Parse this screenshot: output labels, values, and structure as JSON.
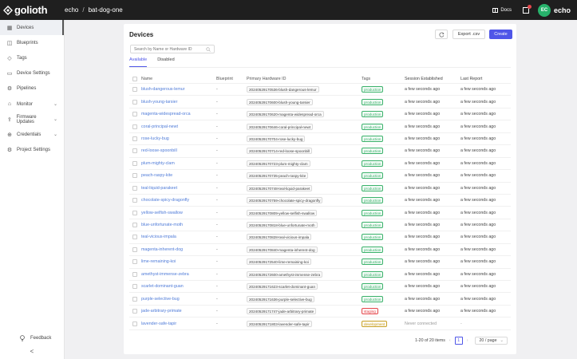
{
  "topbar": {
    "logo_text": "golioth",
    "breadcrumb": [
      "echo",
      "bat-dog-one"
    ],
    "docs_label": "Docs",
    "avatar_initials": "EC",
    "user_name": "echo"
  },
  "sidebar": {
    "items": [
      {
        "label": "Devices",
        "icon": "devices-icon",
        "active": true
      },
      {
        "label": "Blueprints",
        "icon": "blueprint-icon"
      },
      {
        "label": "Tags",
        "icon": "tag-icon"
      },
      {
        "label": "Device Settings",
        "icon": "settings-icon"
      },
      {
        "label": "Pipelines",
        "icon": "pipeline-icon"
      },
      {
        "label": "Monitor",
        "icon": "monitor-icon",
        "chevron": true
      },
      {
        "label": "Firmware Updates",
        "icon": "firmware-icon",
        "chevron": true
      },
      {
        "label": "Credentials",
        "icon": "credentials-icon",
        "chevron": true
      },
      {
        "label": "Project Settings",
        "icon": "project-settings-icon"
      }
    ],
    "feedback_label": "Feedback",
    "collapse_glyph": "<"
  },
  "main": {
    "title": "Devices",
    "export_label": "Export .csv",
    "create_label": "Create",
    "search_placeholder": "Search by Name or Hardware ID",
    "tabs": [
      "Available",
      "Disabled"
    ],
    "columns": [
      "Name",
      "Blueprint",
      "Primary Hardware ID",
      "Tags",
      "Session Established",
      "Last Report"
    ],
    "rows": [
      {
        "name": "blush-dangerous-lemur",
        "blueprint": "-",
        "hw": "20240529170536-blush-dangerous-lemur",
        "tag": "production",
        "session": "a few seconds ago",
        "last": "a few seconds ago"
      },
      {
        "name": "blush-young-tarsier",
        "blueprint": "-",
        "hw": "20240529170600-blush-young-tarsier",
        "tag": "production",
        "session": "a few seconds ago",
        "last": "a few seconds ago"
      },
      {
        "name": "magenta-widespread-orca",
        "blueprint": "-",
        "hw": "20240529170620-magenta-widespread-orca",
        "tag": "production",
        "session": "a few seconds ago",
        "last": "a few seconds ago"
      },
      {
        "name": "coral-principal-newt",
        "blueprint": "-",
        "hw": "20240529170646-coral-principal-newt",
        "tag": "production",
        "session": "a few seconds ago",
        "last": "a few seconds ago"
      },
      {
        "name": "rose-lucky-bug",
        "blueprint": "-",
        "hw": "20240529170704-rose-lucky-bug",
        "tag": "production",
        "session": "a few seconds ago",
        "last": "a few seconds ago"
      },
      {
        "name": "red-loose-spoonbill",
        "blueprint": "-",
        "hw": "20240529170714-red-loose-spoonbill",
        "tag": "production",
        "session": "a few seconds ago",
        "last": "a few seconds ago"
      },
      {
        "name": "plum-mighty-clam",
        "blueprint": "-",
        "hw": "20240529170723-plum-mighty-clam",
        "tag": "production",
        "session": "a few seconds ago",
        "last": "a few seconds ago"
      },
      {
        "name": "peach-raspy-kite",
        "blueprint": "-",
        "hw": "20240529170735-peach-raspy-kite",
        "tag": "production",
        "session": "a few seconds ago",
        "last": "a few seconds ago"
      },
      {
        "name": "teal-liquid-parakeet",
        "blueprint": "-",
        "hw": "20240529170748-teal-liquid-parakeet",
        "tag": "production",
        "session": "a few seconds ago",
        "last": "a few seconds ago"
      },
      {
        "name": "chocolate-spicy-dragonfly",
        "blueprint": "-",
        "hw": "20240529170759-chocolate-spicy-dragonfly",
        "tag": "production",
        "session": "a few seconds ago",
        "last": "a few seconds ago"
      },
      {
        "name": "yellow-selfish-swallow",
        "blueprint": "-",
        "hw": "20240529170809-yellow-selfish-swallow",
        "tag": "production",
        "session": "a few seconds ago",
        "last": "a few seconds ago"
      },
      {
        "name": "blue-unfortunate-moth",
        "blueprint": "-",
        "hw": "20240529170818-blue-unfortunate-moth",
        "tag": "production",
        "session": "a few seconds ago",
        "last": "a few seconds ago"
      },
      {
        "name": "teal-vicious-impala",
        "blueprint": "-",
        "hw": "20240529170828-teal-vicious-impala",
        "tag": "production",
        "session": "a few seconds ago",
        "last": "a few seconds ago"
      },
      {
        "name": "magenta-inherent-dog",
        "blueprint": "-",
        "hw": "20240529170840-magenta-inherent-dog",
        "tag": "production",
        "session": "a few seconds ago",
        "last": "a few seconds ago"
      },
      {
        "name": "lime-remaining-koi",
        "blueprint": "-",
        "hw": "20240529172540-lime-remaining-koi",
        "tag": "production",
        "session": "a few seconds ago",
        "last": "a few seconds ago"
      },
      {
        "name": "amethyst-immense-zebra",
        "blueprint": "-",
        "hw": "20240529172600-amethyst-immense-zebra",
        "tag": "production",
        "session": "a few seconds ago",
        "last": "a few seconds ago"
      },
      {
        "name": "scarlet-dominant-guan",
        "blueprint": "-",
        "hw": "20240529171623-scarlet-dominant-guan",
        "tag": "production",
        "session": "a few seconds ago",
        "last": "a few seconds ago"
      },
      {
        "name": "purple-selective-bug",
        "blueprint": "-",
        "hw": "20240529171636-purple-selective-bug",
        "tag": "production",
        "session": "a few seconds ago",
        "last": "a few seconds ago"
      },
      {
        "name": "jade-arbitrary-primate",
        "blueprint": "-",
        "hw": "20240529171747-jade-arbitrary-primate",
        "tag": "staging",
        "session": "a few seconds ago",
        "last": "a few seconds ago"
      },
      {
        "name": "lavender-safe-tapir",
        "blueprint": "-",
        "hw": "20240529171803-lavender-safe-tapir",
        "tag": "development",
        "session": "Never connected",
        "last": "-"
      }
    ],
    "pagination": {
      "summary": "1-20 of 20 items",
      "page": "1",
      "page_size": "20 / page"
    }
  },
  "colors": {
    "accent": "#4f56e8",
    "link": "#4f7bd8",
    "tag_production": "#3bb26b",
    "tag_staging": "#e5484d",
    "tag_development": "#c9a227"
  }
}
